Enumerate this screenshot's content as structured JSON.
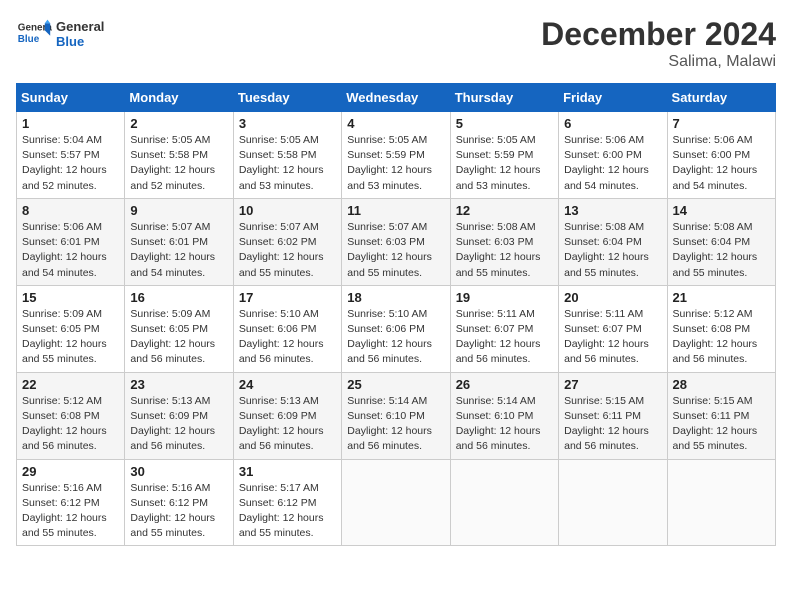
{
  "header": {
    "logo_general": "General",
    "logo_blue": "Blue",
    "month_title": "December 2024",
    "location": "Salima, Malawi"
  },
  "days_of_week": [
    "Sunday",
    "Monday",
    "Tuesday",
    "Wednesday",
    "Thursday",
    "Friday",
    "Saturday"
  ],
  "weeks": [
    [
      {
        "day": "1",
        "info": "Sunrise: 5:04 AM\nSunset: 5:57 PM\nDaylight: 12 hours\nand 52 minutes."
      },
      {
        "day": "2",
        "info": "Sunrise: 5:05 AM\nSunset: 5:58 PM\nDaylight: 12 hours\nand 52 minutes."
      },
      {
        "day": "3",
        "info": "Sunrise: 5:05 AM\nSunset: 5:58 PM\nDaylight: 12 hours\nand 53 minutes."
      },
      {
        "day": "4",
        "info": "Sunrise: 5:05 AM\nSunset: 5:59 PM\nDaylight: 12 hours\nand 53 minutes."
      },
      {
        "day": "5",
        "info": "Sunrise: 5:05 AM\nSunset: 5:59 PM\nDaylight: 12 hours\nand 53 minutes."
      },
      {
        "day": "6",
        "info": "Sunrise: 5:06 AM\nSunset: 6:00 PM\nDaylight: 12 hours\nand 54 minutes."
      },
      {
        "day": "7",
        "info": "Sunrise: 5:06 AM\nSunset: 6:00 PM\nDaylight: 12 hours\nand 54 minutes."
      }
    ],
    [
      {
        "day": "8",
        "info": "Sunrise: 5:06 AM\nSunset: 6:01 PM\nDaylight: 12 hours\nand 54 minutes."
      },
      {
        "day": "9",
        "info": "Sunrise: 5:07 AM\nSunset: 6:01 PM\nDaylight: 12 hours\nand 54 minutes."
      },
      {
        "day": "10",
        "info": "Sunrise: 5:07 AM\nSunset: 6:02 PM\nDaylight: 12 hours\nand 55 minutes."
      },
      {
        "day": "11",
        "info": "Sunrise: 5:07 AM\nSunset: 6:03 PM\nDaylight: 12 hours\nand 55 minutes."
      },
      {
        "day": "12",
        "info": "Sunrise: 5:08 AM\nSunset: 6:03 PM\nDaylight: 12 hours\nand 55 minutes."
      },
      {
        "day": "13",
        "info": "Sunrise: 5:08 AM\nSunset: 6:04 PM\nDaylight: 12 hours\nand 55 minutes."
      },
      {
        "day": "14",
        "info": "Sunrise: 5:08 AM\nSunset: 6:04 PM\nDaylight: 12 hours\nand 55 minutes."
      }
    ],
    [
      {
        "day": "15",
        "info": "Sunrise: 5:09 AM\nSunset: 6:05 PM\nDaylight: 12 hours\nand 55 minutes."
      },
      {
        "day": "16",
        "info": "Sunrise: 5:09 AM\nSunset: 6:05 PM\nDaylight: 12 hours\nand 56 minutes."
      },
      {
        "day": "17",
        "info": "Sunrise: 5:10 AM\nSunset: 6:06 PM\nDaylight: 12 hours\nand 56 minutes."
      },
      {
        "day": "18",
        "info": "Sunrise: 5:10 AM\nSunset: 6:06 PM\nDaylight: 12 hours\nand 56 minutes."
      },
      {
        "day": "19",
        "info": "Sunrise: 5:11 AM\nSunset: 6:07 PM\nDaylight: 12 hours\nand 56 minutes."
      },
      {
        "day": "20",
        "info": "Sunrise: 5:11 AM\nSunset: 6:07 PM\nDaylight: 12 hours\nand 56 minutes."
      },
      {
        "day": "21",
        "info": "Sunrise: 5:12 AM\nSunset: 6:08 PM\nDaylight: 12 hours\nand 56 minutes."
      }
    ],
    [
      {
        "day": "22",
        "info": "Sunrise: 5:12 AM\nSunset: 6:08 PM\nDaylight: 12 hours\nand 56 minutes."
      },
      {
        "day": "23",
        "info": "Sunrise: 5:13 AM\nSunset: 6:09 PM\nDaylight: 12 hours\nand 56 minutes."
      },
      {
        "day": "24",
        "info": "Sunrise: 5:13 AM\nSunset: 6:09 PM\nDaylight: 12 hours\nand 56 minutes."
      },
      {
        "day": "25",
        "info": "Sunrise: 5:14 AM\nSunset: 6:10 PM\nDaylight: 12 hours\nand 56 minutes."
      },
      {
        "day": "26",
        "info": "Sunrise: 5:14 AM\nSunset: 6:10 PM\nDaylight: 12 hours\nand 56 minutes."
      },
      {
        "day": "27",
        "info": "Sunrise: 5:15 AM\nSunset: 6:11 PM\nDaylight: 12 hours\nand 56 minutes."
      },
      {
        "day": "28",
        "info": "Sunrise: 5:15 AM\nSunset: 6:11 PM\nDaylight: 12 hours\nand 55 minutes."
      }
    ],
    [
      {
        "day": "29",
        "info": "Sunrise: 5:16 AM\nSunset: 6:12 PM\nDaylight: 12 hours\nand 55 minutes."
      },
      {
        "day": "30",
        "info": "Sunrise: 5:16 AM\nSunset: 6:12 PM\nDaylight: 12 hours\nand 55 minutes."
      },
      {
        "day": "31",
        "info": "Sunrise: 5:17 AM\nSunset: 6:12 PM\nDaylight: 12 hours\nand 55 minutes."
      },
      {
        "day": "",
        "info": ""
      },
      {
        "day": "",
        "info": ""
      },
      {
        "day": "",
        "info": ""
      },
      {
        "day": "",
        "info": ""
      }
    ]
  ]
}
